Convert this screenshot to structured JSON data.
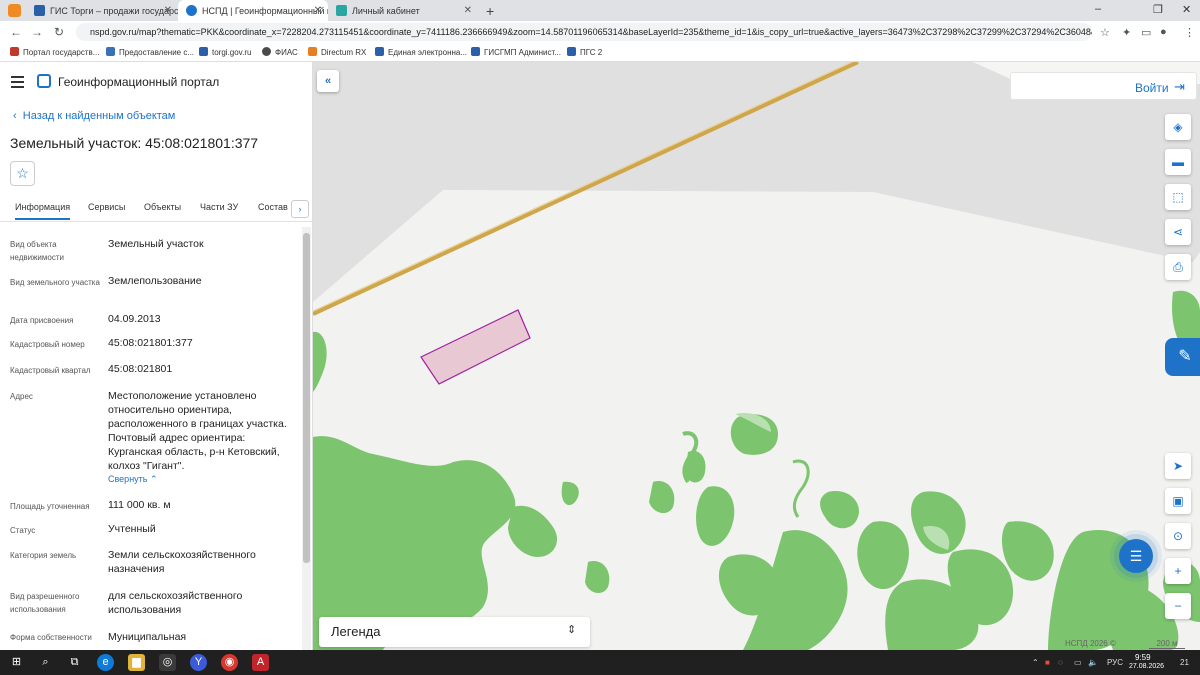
{
  "browser": {
    "tabs": [
      {
        "title": "ГИС Торги – продажи государс",
        "color": "#2b5fa8"
      },
      {
        "title": "НСПД | Геоинформационный п",
        "color": "#1e73c8"
      },
      {
        "title": "Личный кабинет",
        "color": "#2aa6a0"
      }
    ],
    "url": "nspd.gov.ru/map?thematic=PKK&coordinate_x=7228204.273115451&coordinate_y=7411186.236666949&zoom=14.58701196065314&baseLayerId=235&theme_id=1&is_copy_url=true&active_layers=36473%2C37298%2C37299%2C37294%2C36048&s...",
    "bookmarks": [
      {
        "label": "Портал государств...",
        "color": "#c0392b"
      },
      {
        "label": "Предоставление с...",
        "color": "#3b6fb6"
      },
      {
        "label": "torgi.gov.ru",
        "color": "#2b5fa8"
      },
      {
        "label": "ФИАС",
        "color": "#4a4a4a"
      },
      {
        "label": "Directum RX",
        "color": "#e67e22"
      },
      {
        "label": "Единая электронна...",
        "color": "#2b5fa8"
      },
      {
        "label": "ГИСГМП Админист...",
        "color": "#2b5fa8"
      },
      {
        "label": "ПГС 2",
        "color": "#2b5fa8"
      }
    ]
  },
  "portal": {
    "title": "Геоинформационный портал",
    "back_link": "Назад к найденным объектам",
    "page_title": "Земельный участок: 45:08:021801:377",
    "tabs": [
      "Информация",
      "Сервисы",
      "Объекты",
      "Части ЗУ",
      "Состав"
    ],
    "tab_next": "›",
    "fields": [
      {
        "label": "Вид объекта недвижимости",
        "value": "Земельный участок"
      },
      {
        "label": "Вид земельного участка",
        "value": "Землепользование"
      },
      {
        "label": "Дата присвоения",
        "value": "04.09.2013"
      },
      {
        "label": "Кадастровый номер",
        "value": "45:08:021801:377"
      },
      {
        "label": "Кадастровый квартал",
        "value": "45:08:021801"
      },
      {
        "label": "Адрес",
        "value": "Местоположение установлено относительно ориентира, расположенного в границах участка. Почтовый адрес ориентира: Курганская область, р-н Кетовский, колхоз \"Гигант\"."
      },
      {
        "label": "Площадь уточненная",
        "value": "111 000 кв. м"
      },
      {
        "label": "Статус",
        "value": "Учтенный"
      },
      {
        "label": "Категория земель",
        "value": "Земли сельскохозяйственного назначения"
      },
      {
        "label": "Вид разрешенного использования",
        "value": "для сельскохозяйственного использования"
      },
      {
        "label": "Форма собственности",
        "value": "Муниципальная"
      }
    ],
    "collapse_link": "Свернуть"
  },
  "map": {
    "login_label": "Войти",
    "legend_label": "Легенда",
    "copyright": "НСПД 2026 ©",
    "scale_label": "200 м",
    "parcel_color": "#a020a0",
    "forest_color": "#79c26b",
    "road_color": "#d4a94c"
  },
  "taskbar": {
    "language": "РУС",
    "time": "9:59",
    "date": "27.08.2026",
    "notifications": "21"
  },
  "window_controls": {
    "minimize": "–",
    "restore": "❐",
    "close": "✕"
  }
}
